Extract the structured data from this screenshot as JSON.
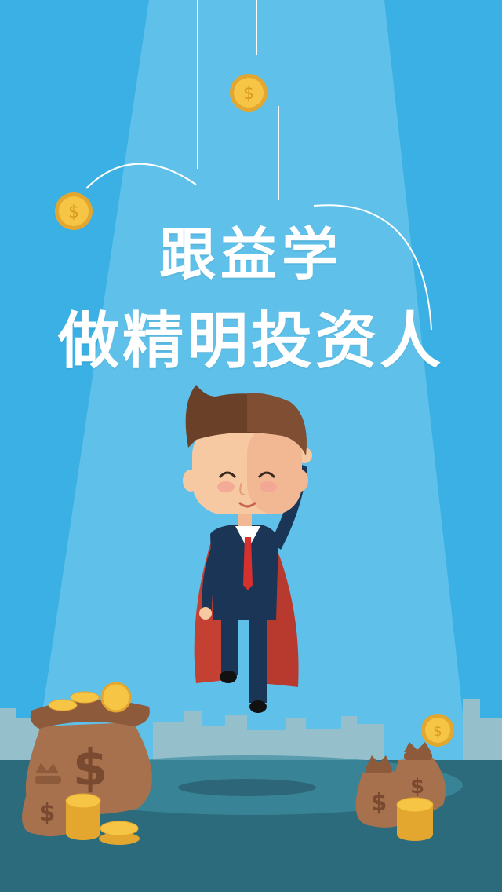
{
  "headline": {
    "line1": "跟益学",
    "line2": "做精明投资人"
  },
  "coin_symbol": "$",
  "colors": {
    "sky": "#3bb0e4",
    "spotlight": "#66c3ea",
    "coin": "#f6c545",
    "coin_dark": "#e3a72f",
    "bag": "#a8714e",
    "cape": "#c44033",
    "suit": "#1b3557",
    "tie": "#d6312f",
    "ground": "#2b6b7c",
    "city": "#94bfcb"
  }
}
